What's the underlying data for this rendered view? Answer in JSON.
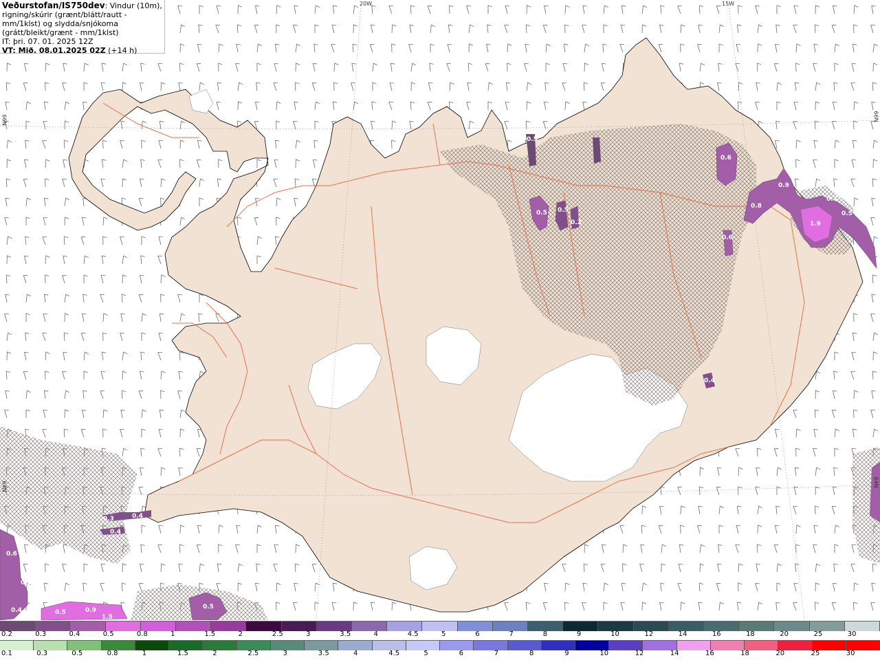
{
  "header": {
    "brand": "Veðurstofan/IS750dev",
    "description": ": Vindur (10m), rigning/skúrir (grænt/blátt/rautt - mm/1klst) og slydda/snjókoma (grátt/bleikt/grænt - mm/1klst)",
    "it": "IT: þri. 07. 01. 2025 12Z",
    "vt_label": "VT: Mið. 08.01.2025 02Z",
    "vt_offset": " (+14 h)"
  },
  "graticule": {
    "lon_top": [
      "20W",
      "15W"
    ],
    "lat_left": [
      "66N",
      "64N"
    ],
    "lat_right": [
      "66N",
      "64N"
    ]
  },
  "precip_labels": [
    "0.5",
    "0.5",
    "0.5",
    "0.6",
    "0.9",
    "0.8",
    "1.9",
    "0.4",
    "0.5",
    "0.6",
    "0.4",
    "0.4",
    "0.5",
    "0.5",
    "0.9",
    "0.4",
    "0.6",
    "0.3",
    "0.5",
    "0.2",
    "0.4",
    "1.5"
  ],
  "scale_snow": {
    "labels": [
      "0.2",
      "0.3",
      "0.4",
      "0.5",
      "0.8",
      "1",
      "1.5",
      "2",
      "2.5",
      "3",
      "3.5",
      "4",
      "4.5",
      "5",
      "6",
      "7",
      "8",
      "9",
      "10",
      "12",
      "14",
      "16",
      "18",
      "20",
      "25",
      "30"
    ],
    "colors": [
      "#6c4a73",
      "#80508a",
      "#a35ea8",
      "#e06ee0",
      "#d060d8",
      "#b050b8",
      "#983c9c",
      "#3c0a40",
      "#4a1a55",
      "#6a3a80",
      "#8a6aa8",
      "#a8a0e0",
      "#c0c0f0",
      "#7f8fd8",
      "#6d80c0",
      "#3a6070",
      "#0d2a34",
      "#1b3a44",
      "#2b4a54",
      "#3a5c64",
      "#4a6c70",
      "#5a7a78",
      "#6d8a8a",
      "#849b9b",
      "#cfd8d8",
      "#ffffff"
    ]
  },
  "scale_rain": {
    "labels": [
      "0.1",
      "0.3",
      "0.5",
      "0.8",
      "1",
      "1.5",
      "2",
      "2.5",
      "3",
      "3.5",
      "4",
      "4.5",
      "5",
      "6",
      "7",
      "8",
      "9",
      "10",
      "12",
      "14",
      "16",
      "18",
      "20",
      "25",
      "30"
    ],
    "colors": [
      "#d8f0d0",
      "#b8e0b0",
      "#80c078",
      "#3a8a3a",
      "#0a4a0a",
      "#1a6a2a",
      "#2a7a3a",
      "#3a8a5a",
      "#5a8a7a",
      "#7a9aa0",
      "#9aaad0",
      "#b8c0e8",
      "#c8c8f8",
      "#9a9af0",
      "#7878e0",
      "#5a5ad0",
      "#3030c0",
      "#0000a0",
      "#5a40c0",
      "#a070e0",
      "#f0a0f0",
      "#f080b0",
      "#f06080",
      "#f02040",
      "#ff0000",
      "#ff0000"
    ]
  }
}
